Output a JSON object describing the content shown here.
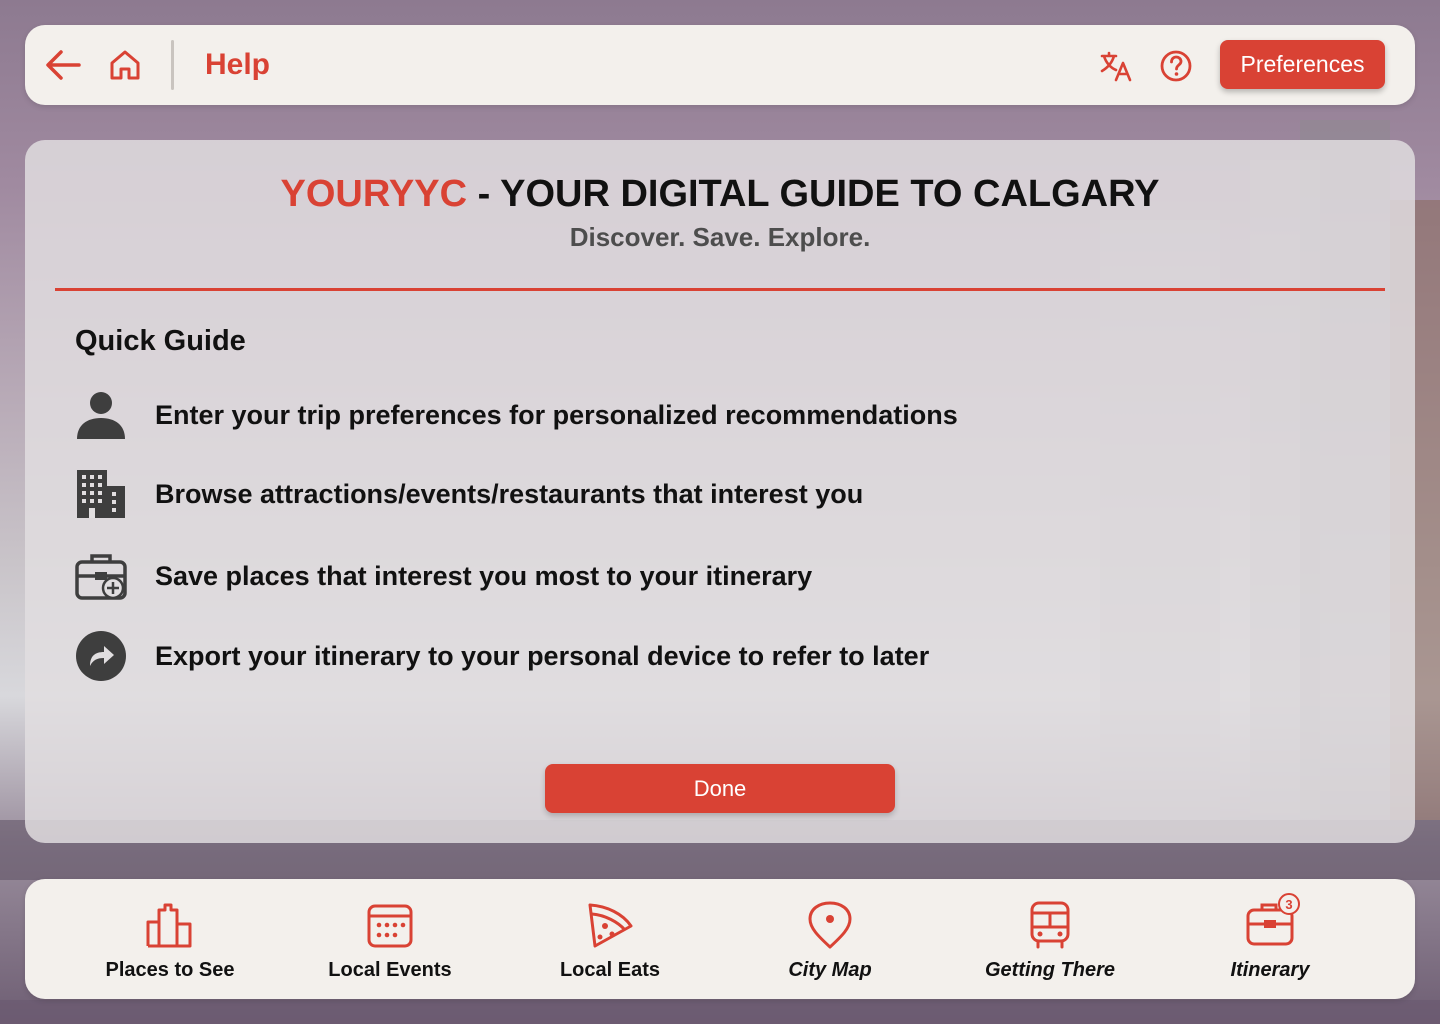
{
  "colors": {
    "accent": "#d94234",
    "text": "#111111",
    "panel": "#e1dee0",
    "bar": "#f3f0ec"
  },
  "header": {
    "back_icon": "arrow-left-icon",
    "home_icon": "home-icon",
    "title": "Help",
    "translate_icon": "translate-icon",
    "help_icon": "question-circle-icon",
    "preferences_label": "Preferences"
  },
  "panel": {
    "brand": "YOURYYC",
    "title_rest": " - YOUR DIGITAL GUIDE TO CALGARY",
    "subtitle": "Discover. Save. Explore.",
    "guide_heading": "Quick Guide",
    "items": [
      {
        "icon": "person-icon",
        "text": "Enter your trip preferences for personalized recommendations"
      },
      {
        "icon": "buildings-icon",
        "text": "Browse attractions/events/restaurants that interest you"
      },
      {
        "icon": "briefcase-add-icon",
        "text": "Save places that interest you most to your itinerary"
      },
      {
        "icon": "share-arrow-icon",
        "text": "Export your itinerary to your personal device to refer to later"
      }
    ],
    "done_label": "Done"
  },
  "nav": {
    "items": [
      {
        "label": "Places to See",
        "icon": "city-buildings-icon"
      },
      {
        "label": "Local Events",
        "icon": "calendar-icon"
      },
      {
        "label": "Local Eats",
        "icon": "pizza-icon"
      },
      {
        "label": "City Map",
        "icon": "map-pin-icon"
      },
      {
        "label": "Getting There",
        "icon": "bus-icon"
      },
      {
        "label": "Itinerary",
        "icon": "briefcase-icon",
        "badge": "3"
      }
    ]
  }
}
